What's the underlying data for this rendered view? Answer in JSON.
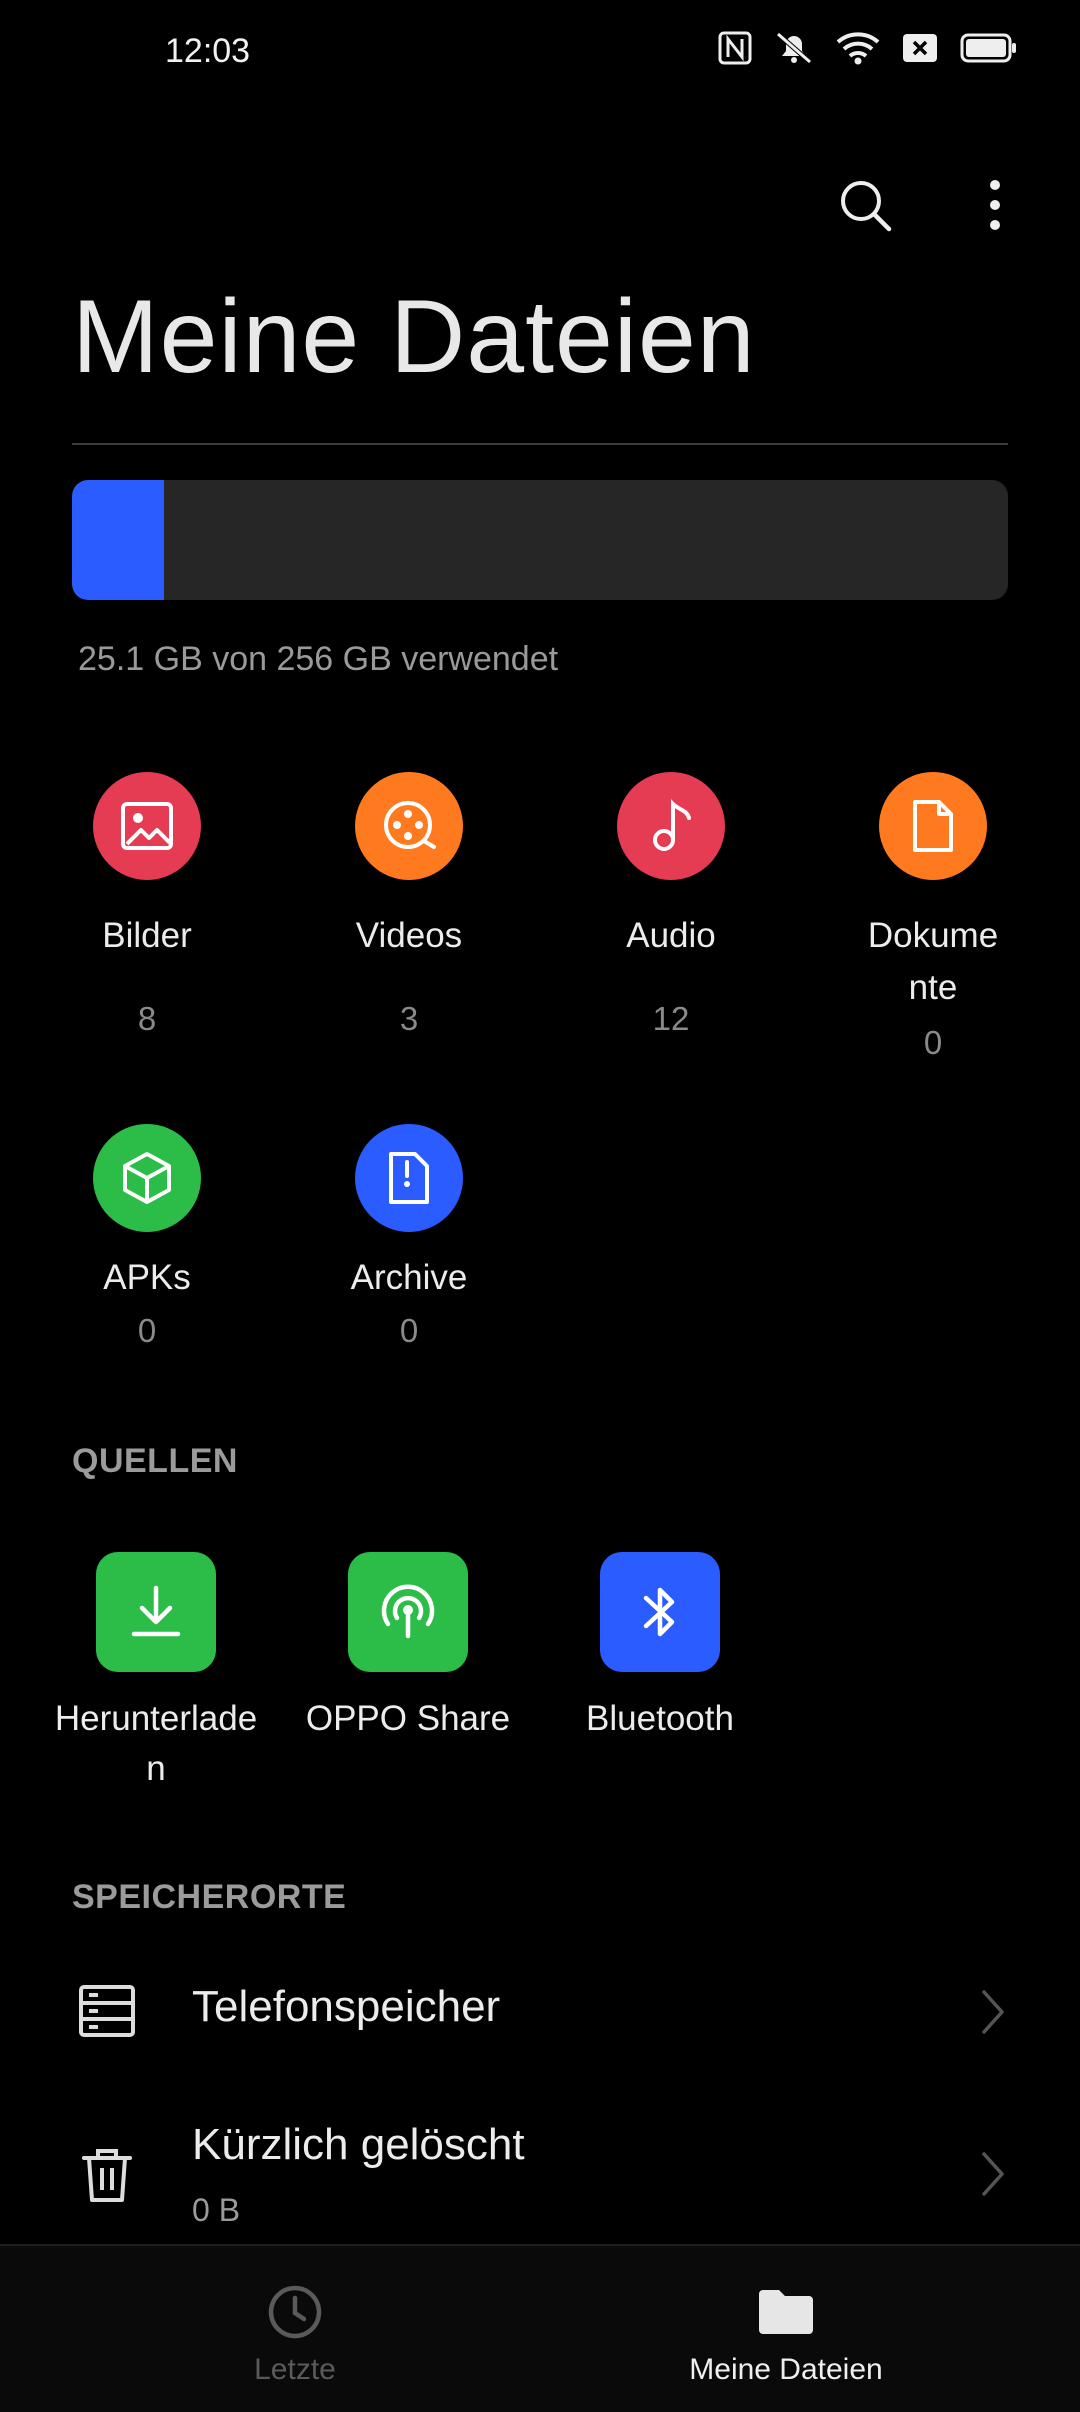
{
  "status_bar": {
    "time": "12:03",
    "icons": [
      "nfc-icon",
      "mute-icon",
      "wifi-icon",
      "close-box-icon",
      "battery-icon"
    ]
  },
  "header": {
    "title": "Meine Dateien",
    "actions": [
      "search-icon",
      "more-vertical-icon"
    ]
  },
  "storage": {
    "used_fraction": 0.098,
    "text": "25.1 GB von 256 GB verwendet",
    "fill_color": "#2b5cff"
  },
  "categories": [
    {
      "label": "Bilder",
      "count": "8",
      "icon": "image-icon",
      "color": "#e53b53"
    },
    {
      "label": "Videos",
      "count": "3",
      "icon": "film-reel-icon",
      "color": "#ff7a1f"
    },
    {
      "label": "Audio",
      "count": "12",
      "icon": "music-note-icon",
      "color": "#e53b53"
    },
    {
      "label": "Dokume\nnte",
      "count": "0",
      "icon": "document-icon",
      "color": "#ff7a1f"
    },
    {
      "label": "APKs",
      "count": "0",
      "icon": "package-icon",
      "color": "#2bbd48"
    },
    {
      "label": "Archive",
      "count": "0",
      "icon": "archive-icon",
      "color": "#2b5cff"
    }
  ],
  "sources": {
    "heading": "QUELLEN",
    "items": [
      {
        "label": "Herunterlade\nn",
        "icon": "download-icon",
        "color": "#2bbd48"
      },
      {
        "label": "OPPO Share",
        "icon": "share-signal-icon",
        "color": "#2bbd48"
      },
      {
        "label": "Bluetooth",
        "icon": "bluetooth-icon",
        "color": "#2b5cff"
      }
    ]
  },
  "locations": {
    "heading": "SPEICHERORTE",
    "items": [
      {
        "label": "Telefonspeicher",
        "sub": "",
        "icon": "storage-icon"
      },
      {
        "label": "Kürzlich gelöscht",
        "sub": "0 B",
        "icon": "trash-icon"
      }
    ]
  },
  "bottom_nav": {
    "items": [
      {
        "label": "Letzte",
        "icon": "clock-icon",
        "active": false
      },
      {
        "label": "Meine Dateien",
        "icon": "folder-icon",
        "active": true
      }
    ]
  }
}
